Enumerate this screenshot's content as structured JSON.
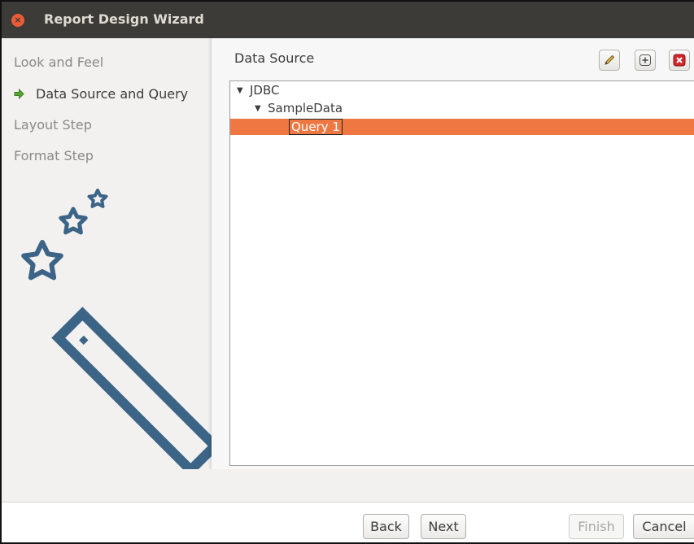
{
  "window": {
    "title": "Report Design Wizard"
  },
  "steps": [
    {
      "label": "Look and Feel",
      "active": false
    },
    {
      "label": "Data Source and Query",
      "active": true
    },
    {
      "label": "Layout Step",
      "active": false
    },
    {
      "label": "Format Step",
      "active": false
    }
  ],
  "data_source": {
    "label": "Data Source",
    "toolbar": {
      "edit_icon": "pencil-icon",
      "add_icon": "plus-icon",
      "delete_icon": "delete-icon"
    },
    "tree": {
      "root": "JDBC",
      "child": "SampleData",
      "selected_query": "Query 1"
    }
  },
  "buttons": {
    "back": "Back",
    "next": "Next",
    "finish": "Finish",
    "cancel": "Cancel"
  },
  "colors": {
    "selection": "#ef7842",
    "wand": "#3b6486",
    "titlebar": "#3c3b37",
    "close": "#e95c37",
    "active_arrow": "#55a632"
  }
}
